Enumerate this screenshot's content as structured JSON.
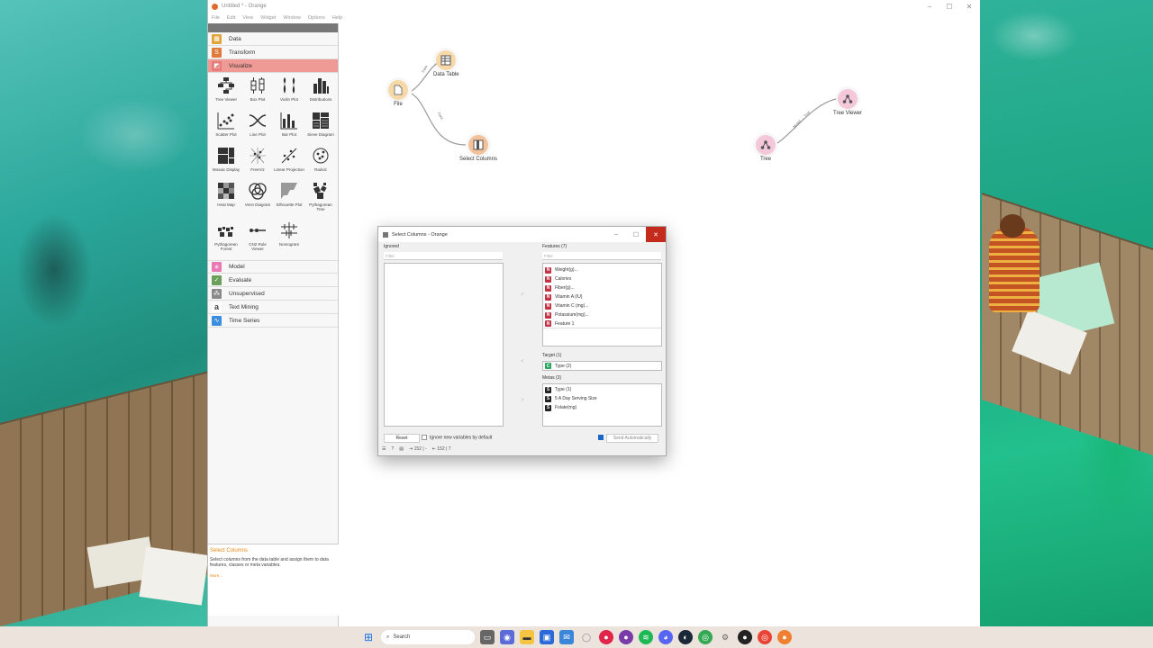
{
  "window": {
    "title": "Untitled * - Orange",
    "min": "–",
    "max": "☐",
    "close": "✕"
  },
  "menu": [
    "File",
    "Edit",
    "View",
    "Widget",
    "Window",
    "Options",
    "Help"
  ],
  "categories_top": [
    {
      "label": "Data",
      "icon": "▦",
      "color": "#e0a53a"
    },
    {
      "label": "Transform",
      "icon": "S",
      "color": "#e07a3a"
    },
    {
      "label": "Visualize",
      "icon": "◩",
      "color": "#e57b7b",
      "active": true
    }
  ],
  "widgets": [
    {
      "label": "Tree Viewer",
      "icon": "tree-viewer-icon"
    },
    {
      "label": "Box Plot",
      "icon": "box-plot-icon"
    },
    {
      "label": "Violin Plot",
      "icon": "violin-plot-icon"
    },
    {
      "label": "Distributions",
      "icon": "distributions-icon"
    },
    {
      "label": "Scatter Plot",
      "icon": "scatter-plot-icon"
    },
    {
      "label": "Line Plot",
      "icon": "line-plot-icon"
    },
    {
      "label": "Bar Plot",
      "icon": "bar-plot-icon"
    },
    {
      "label": "Sieve Diagram",
      "icon": "sieve-diagram-icon"
    },
    {
      "label": "Mosaic Display",
      "icon": "mosaic-display-icon"
    },
    {
      "label": "FreeViz",
      "icon": "freeviz-icon"
    },
    {
      "label": "Linear Projection",
      "icon": "linear-projection-icon"
    },
    {
      "label": "Radviz",
      "icon": "radviz-icon"
    },
    {
      "label": "Heat Map",
      "icon": "heat-map-icon"
    },
    {
      "label": "Venn Diagram",
      "icon": "venn-diagram-icon"
    },
    {
      "label": "Silhouette Plot",
      "icon": "silhouette-plot-icon"
    },
    {
      "label": "Pythagorean Tree",
      "icon": "pythagorean-tree-icon"
    },
    {
      "label": "Pythagorean Forest",
      "icon": "pythagorean-forest-icon"
    },
    {
      "label": "CN2 Rule Viewer",
      "icon": "cn2-rule-viewer-icon"
    },
    {
      "label": "Nomogram",
      "icon": "nomogram-icon"
    }
  ],
  "categories_bottom": [
    {
      "label": "Model",
      "icon": "✳",
      "color": "#e879b6"
    },
    {
      "label": "Evaluate",
      "icon": "✓",
      "color": "#6aa05a"
    },
    {
      "label": "Unsupervised",
      "icon": "⁂",
      "color": "#8a8a8a"
    },
    {
      "label": "Text Mining",
      "icon": "a",
      "color": "#444444"
    },
    {
      "label": "Time Series",
      "icon": "∿",
      "color": "#3a8ee0"
    }
  ],
  "help": {
    "title": "Select Columns",
    "body": "Select columns from the data table and assign them to data features, classes or meta variables.",
    "more": "More..."
  },
  "canvas": {
    "nodes": [
      {
        "id": "file",
        "label": "File",
        "color": "#f7d8a8",
        "icon": "file-icon"
      },
      {
        "id": "data-table",
        "label": "Data Table",
        "color": "#f7d8a8",
        "icon": "data-table-icon"
      },
      {
        "id": "select-columns",
        "label": "Select Columns",
        "color": "#f4c29a",
        "icon": "select-columns-icon"
      },
      {
        "id": "tree",
        "label": "Tree",
        "color": "#f4c8d8",
        "icon": "tree-icon"
      },
      {
        "id": "tree-viewer",
        "label": "Tree Viewer",
        "color": "#f4c8d8",
        "icon": "tree-viewer-icon"
      }
    ],
    "links": [
      "Data",
      "Data",
      "Model → Tree"
    ]
  },
  "dialog": {
    "title": "Select Columns - Orange",
    "ignored_label": "Ignored",
    "features_label": "Features (7)",
    "filter_placeholder": "Filter",
    "features": [
      {
        "type": "N",
        "label": "Weight(g)..."
      },
      {
        "type": "N",
        "label": "Calories"
      },
      {
        "type": "N",
        "label": "Fiber(g)..."
      },
      {
        "type": "N",
        "label": "Vitamin A (IU)"
      },
      {
        "type": "N",
        "label": "Vitamin C (mg)..."
      },
      {
        "type": "N",
        "label": "Potassium(mg)..."
      },
      {
        "type": "N",
        "label": "Feature 1"
      }
    ],
    "target_label": "Target (1)",
    "target": {
      "type": "C",
      "label": "Type (2)"
    },
    "metas_label": "Metas (3)",
    "metas": [
      {
        "type": "S",
        "label": "Type (1)"
      },
      {
        "type": "S",
        "label": "5 A Day Serving Size"
      },
      {
        "type": "S",
        "label": "Folate(mg)"
      }
    ],
    "reset_label": "Reset",
    "ignore_new_label": "Ignore new variables by default",
    "send_auto_label": "Send Automatically",
    "status_in": "152 | -",
    "status_out": "152 | 7"
  },
  "taskbar": {
    "search_placeholder": "Search"
  }
}
